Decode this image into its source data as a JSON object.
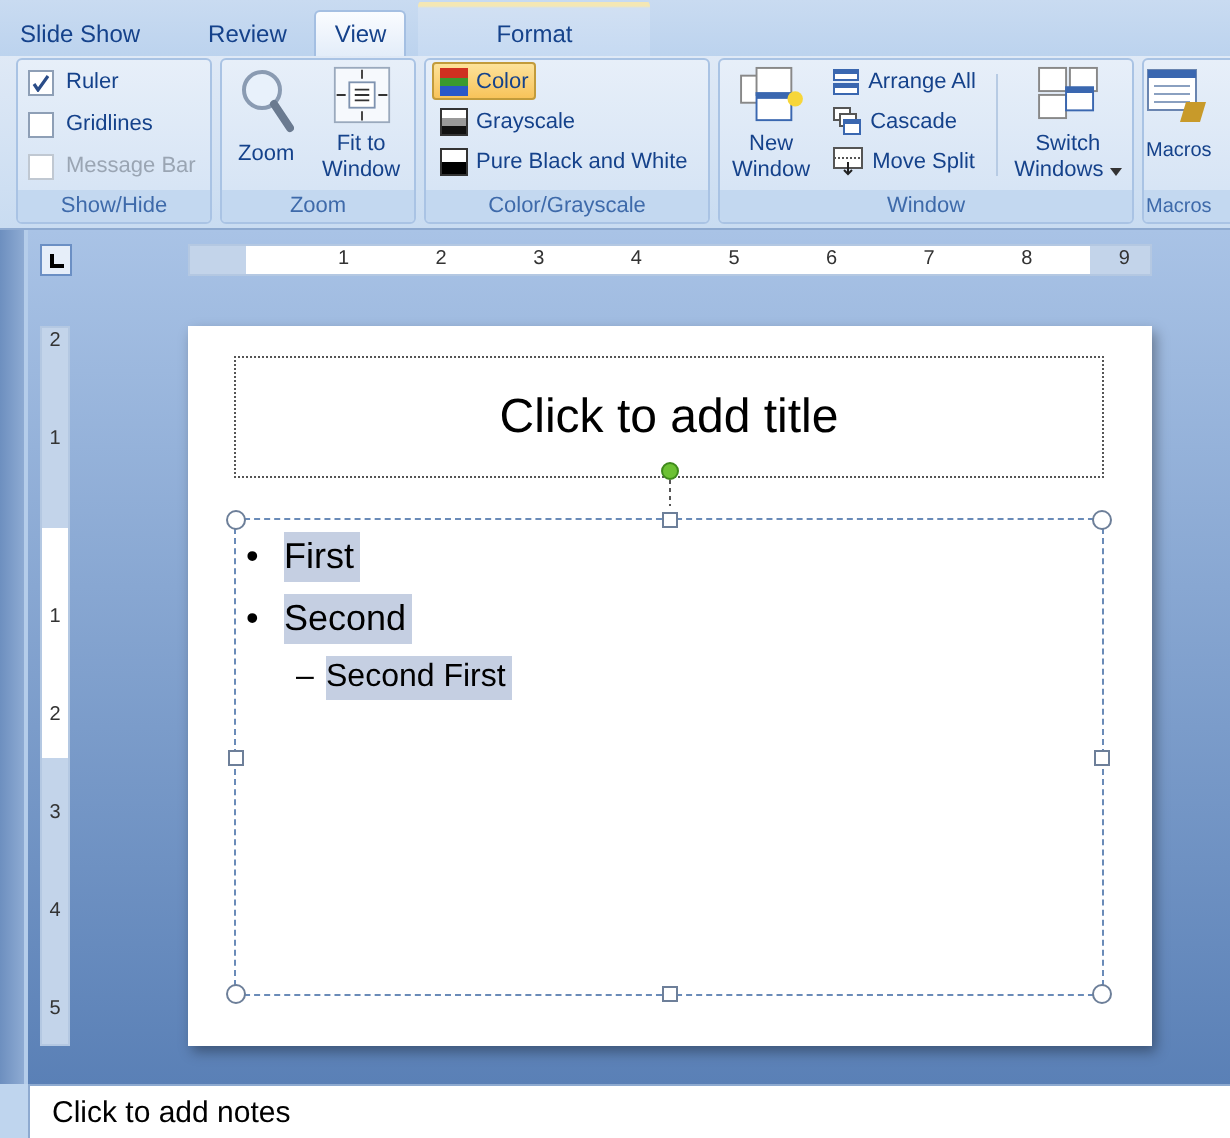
{
  "tabs": [
    {
      "label": "Slide Show",
      "selected": false,
      "kind": "normal"
    },
    {
      "label": "Review",
      "selected": false,
      "kind": "normal"
    },
    {
      "label": "View",
      "selected": true,
      "kind": "normal"
    },
    {
      "label": "Format",
      "selected": false,
      "kind": "contextual"
    }
  ],
  "ribbon": {
    "show_hide": {
      "title": "Show/Hide",
      "items": [
        {
          "label": "Ruler",
          "checked": true,
          "disabled": false
        },
        {
          "label": "Gridlines",
          "checked": false,
          "disabled": false
        },
        {
          "label": "Message Bar",
          "checked": false,
          "disabled": true
        }
      ]
    },
    "zoom": {
      "title": "Zoom",
      "buttons": [
        "Zoom",
        "Fit to Window"
      ]
    },
    "color_grayscale": {
      "title": "Color/Grayscale",
      "items": [
        {
          "label": "Color",
          "selected": true
        },
        {
          "label": "Grayscale",
          "selected": false
        },
        {
          "label": "Pure Black and White",
          "selected": false
        }
      ]
    },
    "window": {
      "title": "Window",
      "new_window": "New Window",
      "small": [
        "Arrange All",
        "Cascade",
        "Move Split"
      ],
      "switch_windows": "Switch Windows"
    },
    "macros": {
      "title": "Macros",
      "button": "Macros"
    }
  },
  "horizontal_ruler": [
    "1",
    "2",
    "3",
    "4",
    "5",
    "6",
    "7",
    "8",
    "9"
  ],
  "vertical_ruler": [
    "2",
    "1",
    "1",
    "2",
    "3",
    "4",
    "5"
  ],
  "slide": {
    "title_placeholder": "Click to add title",
    "bullets": [
      {
        "bullet": "•",
        "text": "First",
        "selected": true
      },
      {
        "bullet": "•",
        "text": "Second",
        "selected": true,
        "children": [
          {
            "bullet": "–",
            "text": "Second First",
            "selected": true
          }
        ]
      }
    ]
  },
  "notes_placeholder": "Click to add notes"
}
